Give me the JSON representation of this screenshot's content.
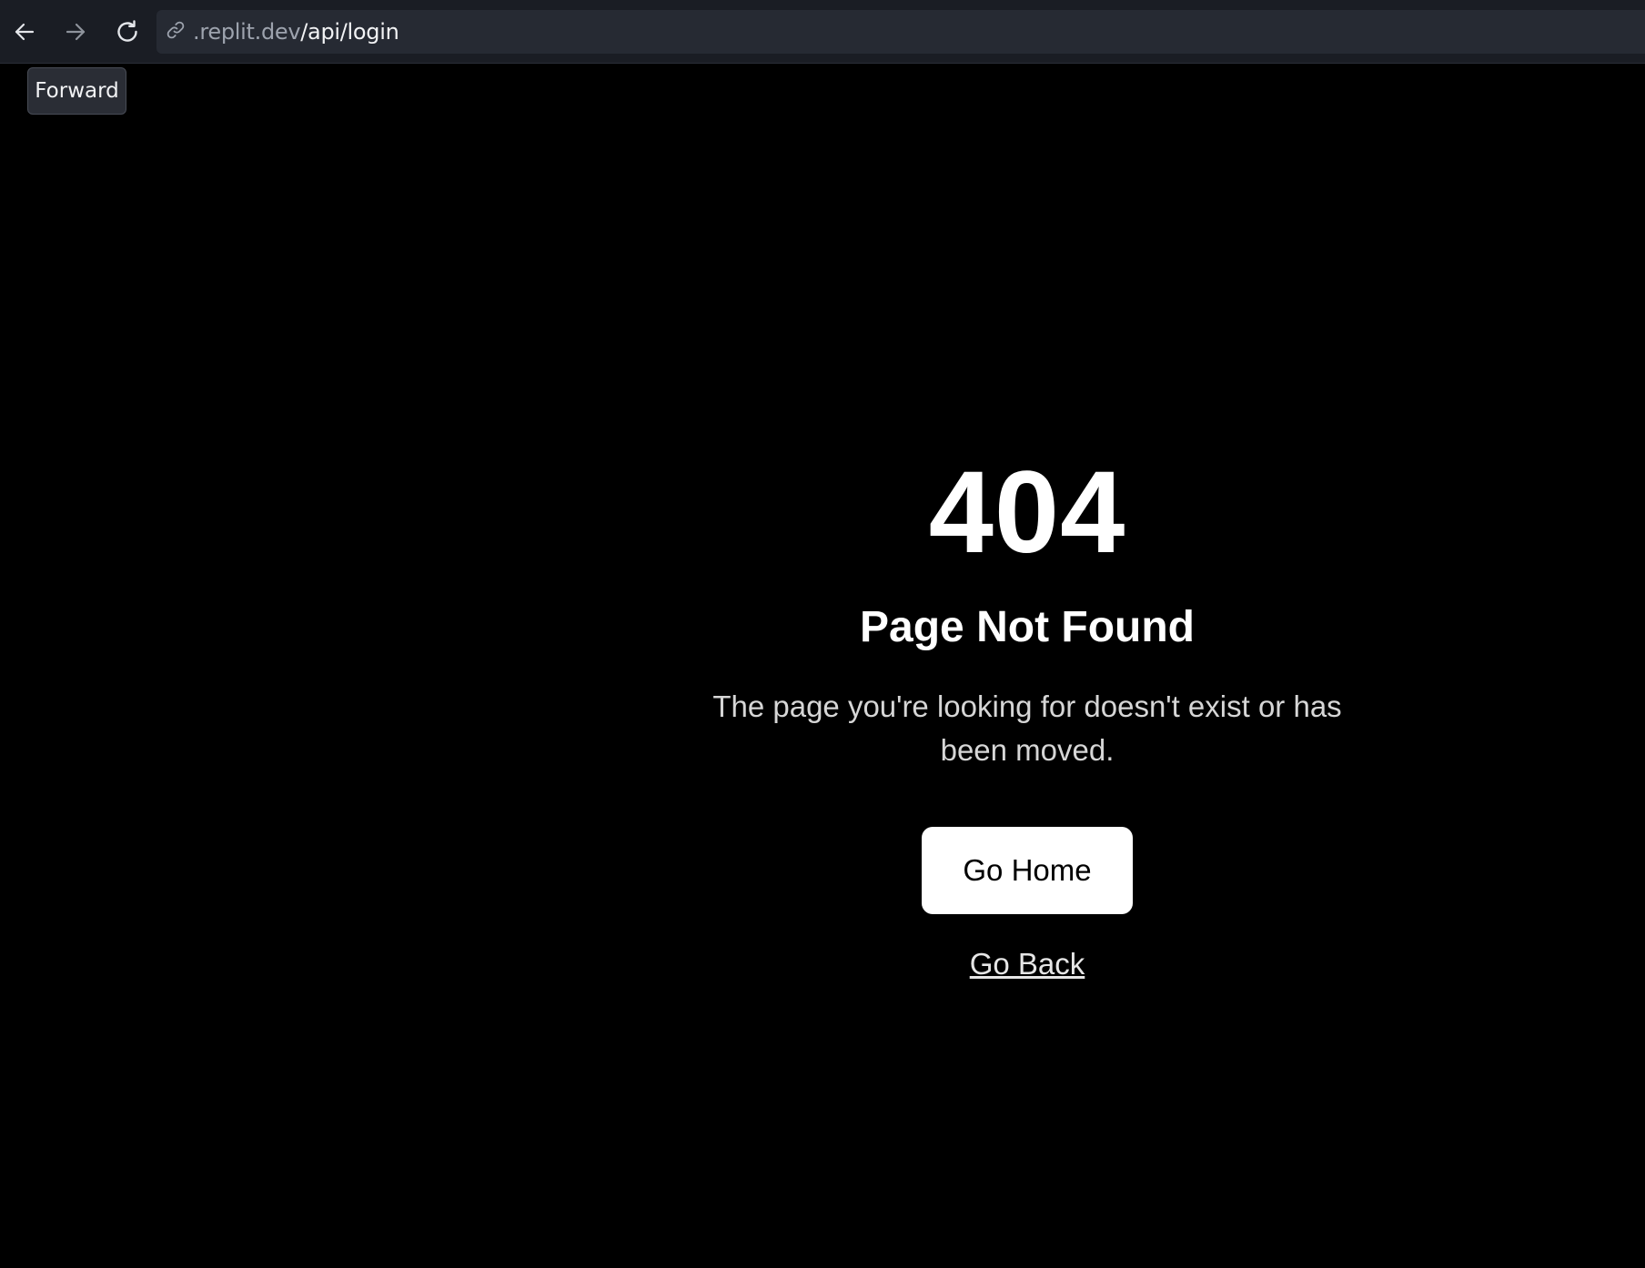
{
  "browser": {
    "back_icon": "arrow-left-icon",
    "forward_icon": "arrow-right-icon",
    "reload_icon": "reload-icon",
    "url": {
      "icon": "link-icon",
      "domain": ".replit.dev",
      "path": "/api/login"
    },
    "tooltip": "Forward"
  },
  "page": {
    "code": "404",
    "title": "Page Not Found",
    "message": "The page you're looking for doesn't exist or has been moved.",
    "home_button": "Go Home",
    "back_link": "Go Back"
  },
  "colors": {
    "background": "#000000",
    "toolbar": "#1a1d24",
    "button_bg": "#ffffff",
    "text": "#ffffff"
  }
}
